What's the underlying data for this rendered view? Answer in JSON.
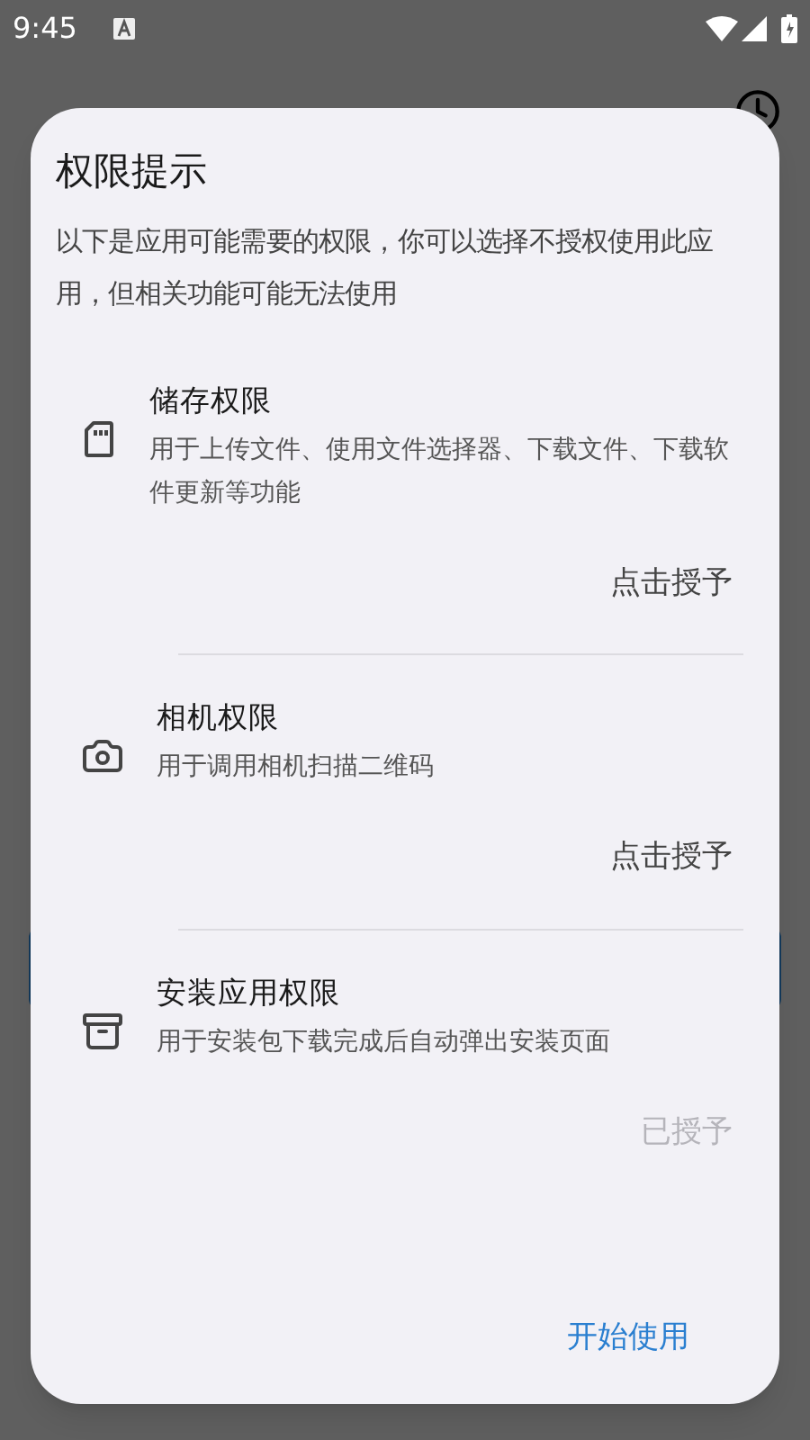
{
  "status_bar": {
    "time": "9:45"
  },
  "dialog": {
    "title": "权限提示",
    "description": "以下是应用可能需要的权限，你可以选择不授权使用此应用，但相关功能可能无法使用",
    "permissions": [
      {
        "kind": "storage",
        "name": "储存权限",
        "description": "用于上传文件、使用文件选择器、下载文件、下载软件更新等功能",
        "action": "点击授予",
        "disabled": false
      },
      {
        "kind": "camera",
        "name": "相机权限",
        "description": "用于调用相机扫描二维码",
        "action": "点击授予",
        "disabled": false
      },
      {
        "kind": "install",
        "name": "安装应用权限",
        "description": "用于安装包下载完成后自动弹出安装页面",
        "action": "已授予",
        "disabled": true
      }
    ],
    "confirm": "开始使用"
  }
}
